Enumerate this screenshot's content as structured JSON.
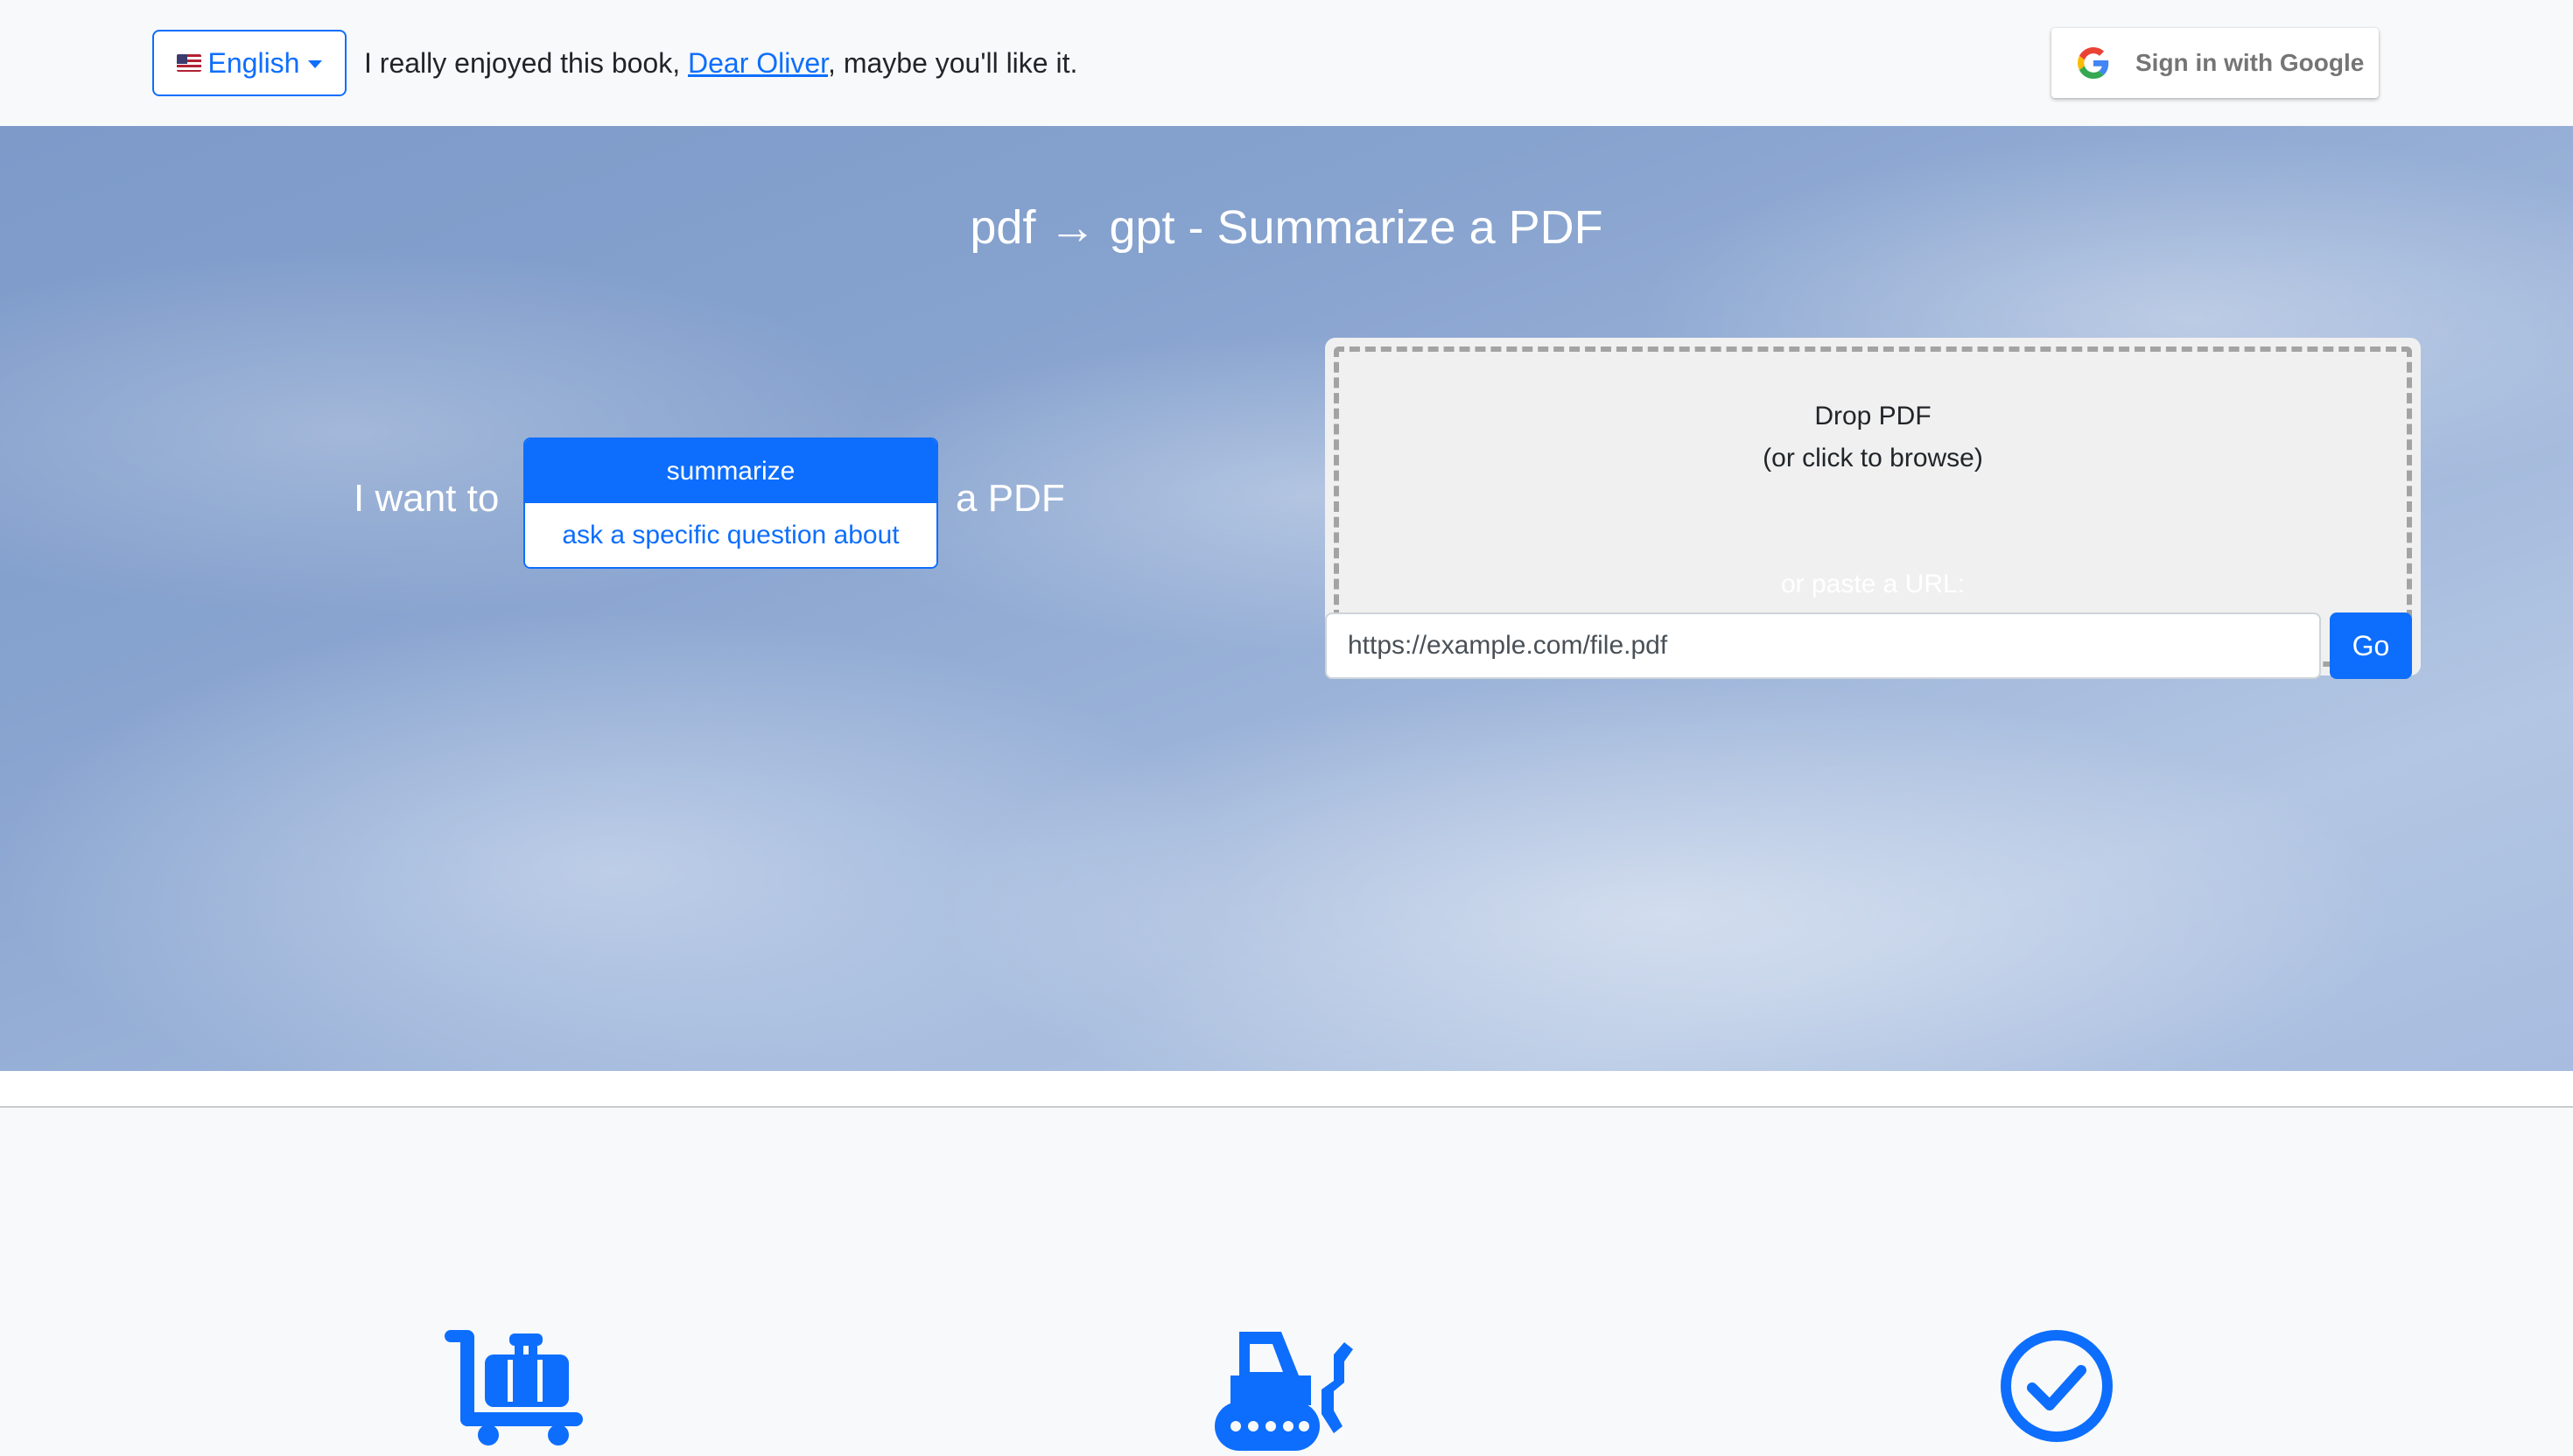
{
  "topbar": {
    "language_label": "English",
    "promo_before": "I really enjoyed this book, ",
    "promo_link": "Dear Oliver",
    "promo_after": ", maybe you'll like it.",
    "google_signin_label": "Sign in with Google"
  },
  "hero": {
    "title": "pdf → gpt - Summarize a PDF",
    "intent_prefix": "I want to",
    "intent_options": [
      {
        "label": "summarize",
        "selected": true
      },
      {
        "label": "ask a specific question about",
        "selected": false
      }
    ],
    "intent_suffix": "a PDF",
    "dropzone_line1": "Drop PDF",
    "dropzone_line2": "(or click to browse)",
    "url_label": "or paste a URL:",
    "url_placeholder": "https://example.com/file.pdf",
    "go_label": "Go"
  },
  "features": {
    "icons": [
      "luggage-cart-icon",
      "bulldozer-icon",
      "check-circle-icon"
    ]
  },
  "colors": {
    "primary": "#0d6efd",
    "topbar_bg": "#f8f9fa",
    "dropzone_bg": "#f0f0f0",
    "dropzone_border": "#a3a3a3",
    "google_text": "#757575"
  }
}
